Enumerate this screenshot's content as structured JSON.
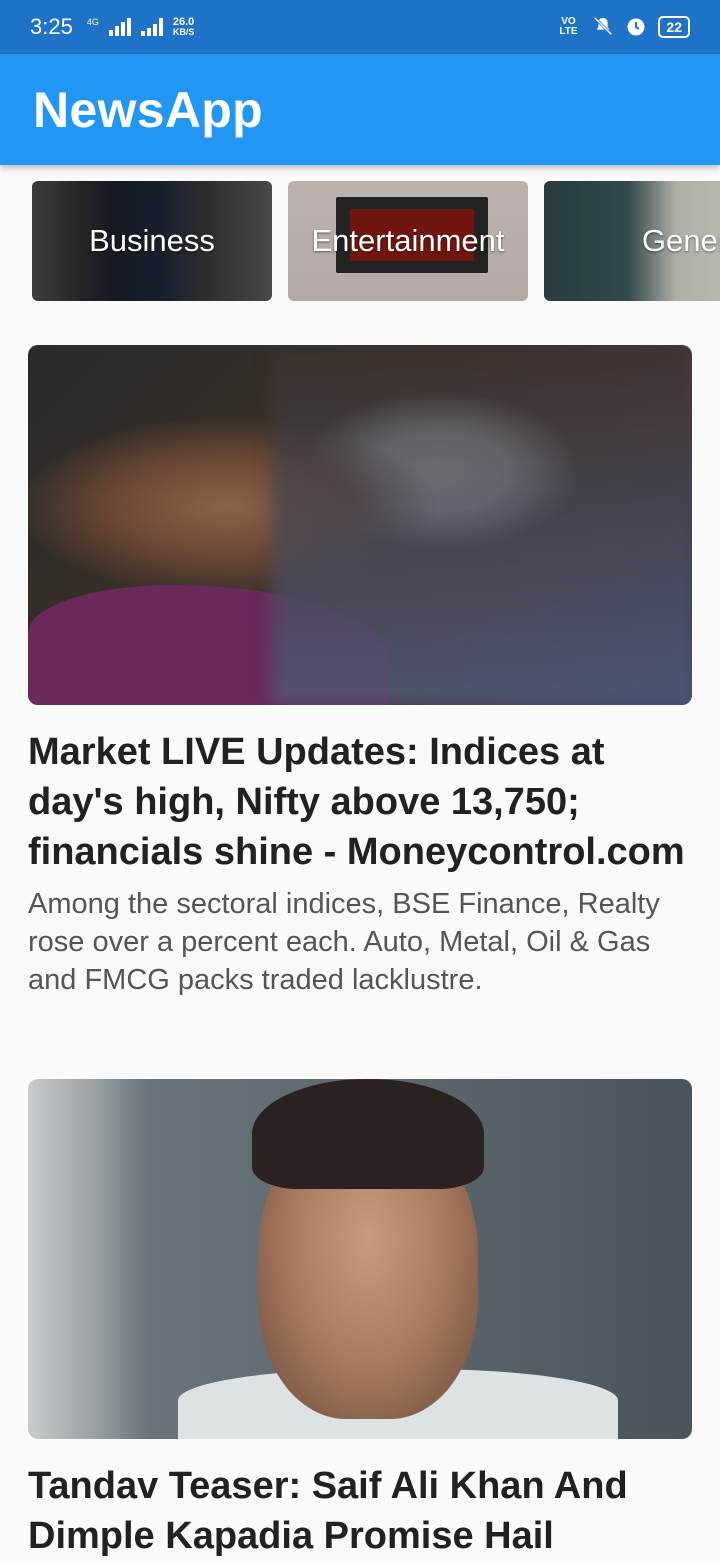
{
  "status_bar": {
    "time": "3:25",
    "network_type": "4G",
    "speed_value": "26.0",
    "speed_unit": "KB/S",
    "volte_label": "VO LTE",
    "battery": "22",
    "icons": [
      "signal-icon",
      "signal-icon",
      "volte-icon",
      "mute-icon",
      "alarm-icon",
      "battery-icon"
    ]
  },
  "app_bar": {
    "title": "NewsApp",
    "color": "#2196f3"
  },
  "categories": [
    {
      "label": "Business"
    },
    {
      "label": "Entertainment"
    },
    {
      "label": "General"
    }
  ],
  "articles": [
    {
      "title": "Market LIVE Updates: Indices at day's high, Nifty above 13,750; financials shine - Moneycontrol.com",
      "description": "Among the sectoral indices, BSE Finance, Realty rose over a percent each. Auto, Metal, Oil & Gas and FMCG packs traded lacklustre."
    },
    {
      "title": "Tandav Teaser: Saif Ali Khan And Dimple Kapadia Promise Hail",
      "description": ""
    }
  ]
}
